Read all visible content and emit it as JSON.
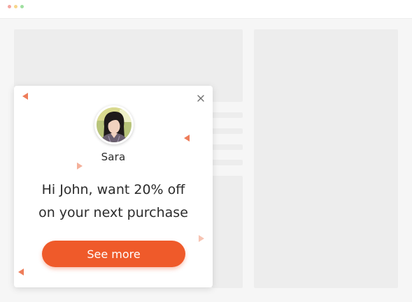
{
  "popup": {
    "name": "Sara",
    "headline_line1": "Hi John, want 20% off",
    "headline_line2": "on your next purchase",
    "cta_label": "See more"
  },
  "icons": {
    "close": "close-icon",
    "avatar": "user-avatar-photo"
  },
  "colors": {
    "accent": "#ef5a2a",
    "triangle": "#ee7d5a",
    "text": "#2b2b2b",
    "placeholder": "#ededed",
    "background": "#f6f6f6"
  }
}
